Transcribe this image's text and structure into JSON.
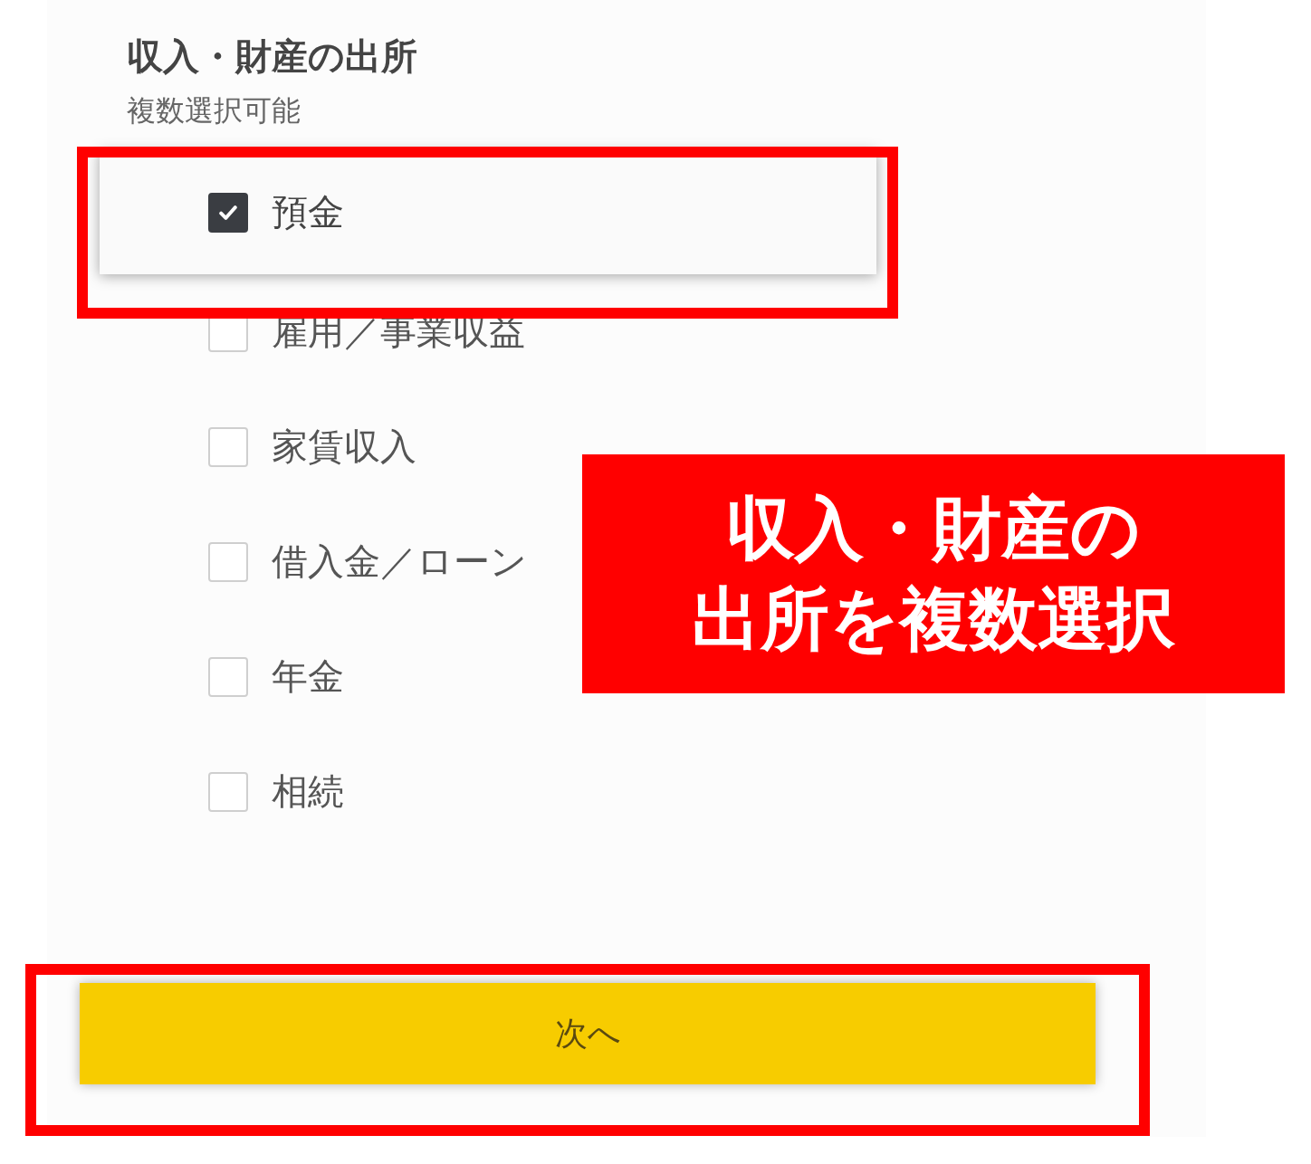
{
  "section": {
    "title": "収入・財産の出所",
    "hint": "複数選択可能"
  },
  "options": [
    {
      "label": "預金",
      "checked": true
    },
    {
      "label": "雇用／事業収益",
      "checked": false
    },
    {
      "label": "家賃収入",
      "checked": false
    },
    {
      "label": "借入金／ローン",
      "checked": false
    },
    {
      "label": "年金",
      "checked": false
    },
    {
      "label": "相続",
      "checked": false
    }
  ],
  "next_button": {
    "label": "次へ"
  },
  "callout": {
    "lines": [
      "収入・財産の",
      "出所を複数選択"
    ]
  }
}
